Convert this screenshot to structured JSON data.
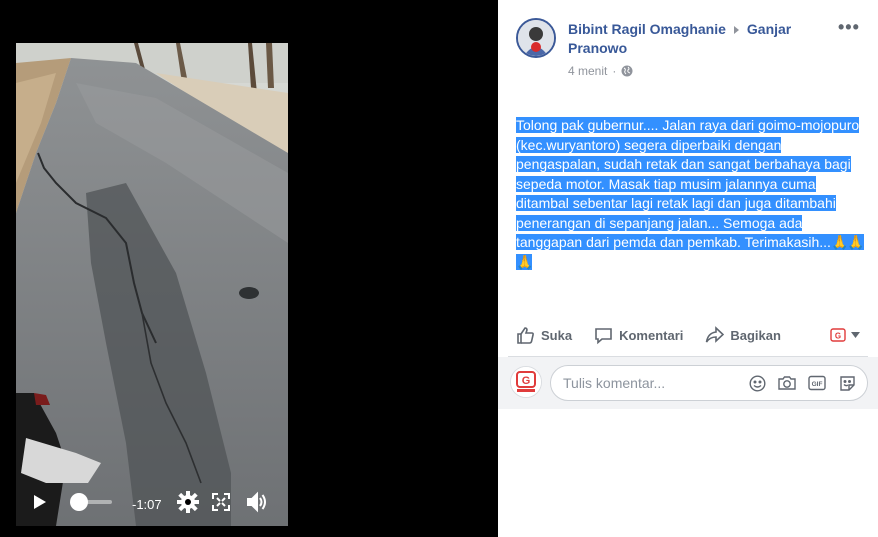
{
  "video": {
    "time_remaining": "-1:07",
    "progress": 0.05,
    "icons": [
      "play-icon",
      "settings-icon",
      "fullscreen-icon",
      "volume-icon"
    ]
  },
  "post": {
    "author": "Bibint Ragil Omaghanie",
    "target": "Ganjar Pranowo",
    "timestamp": "4 menit",
    "privacy_icon": "globe-icon",
    "more_label": "•••",
    "text": "Tolong pak gubernur.... Jalan raya dari goimo-mojopuro (kec.wuryantoro) segera diperbaiki dengan pengaspalan, sudah retak dan sangat berbahaya bagi sepeda motor. Masak tiap musim jalannya cuma ditambal sebentar lagi retak lagi dan juga ditambahi penerangan di sepanjang jalan... Semoga ada tanggapan dari pemda dan pemkab. Terimakasih...",
    "emoji": "🙏🙏🙏",
    "selection_color": "#3390ff",
    "link_color": "#385898"
  },
  "actions": {
    "like": "Suka",
    "comment": "Komentari",
    "share": "Bagikan"
  },
  "comment": {
    "placeholder": "Tulis komentar...",
    "icons": [
      "emoji-icon",
      "camera-icon",
      "gif-icon",
      "sticker-icon"
    ]
  }
}
